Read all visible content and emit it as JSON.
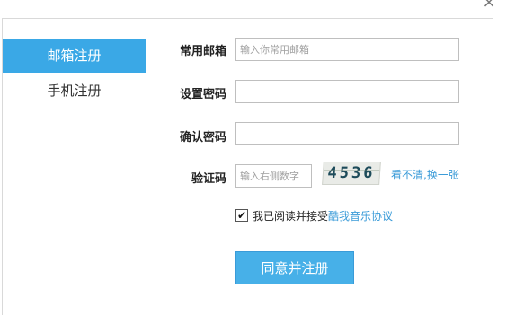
{
  "window": {
    "close_glyph": "×"
  },
  "tabs": [
    {
      "label": "邮箱注册",
      "active": true
    },
    {
      "label": "手机注册",
      "active": false
    }
  ],
  "form": {
    "email_label": "常用邮箱",
    "email_placeholder": "输入你常用邮箱",
    "email_value": "",
    "password_label": "设置密码",
    "password_value": "",
    "confirm_label": "确认密码",
    "confirm_value": "",
    "captcha_label": "验证码",
    "captcha_placeholder": "输入右侧数字",
    "captcha_image_text": "4536",
    "refresh_link": "看不清,换一张",
    "agree_checked": true,
    "agree_text": "我已阅读并接受",
    "agree_link": "酷我音乐协议",
    "submit_label": "同意并注册"
  },
  "colors": {
    "accent": "#3aa8e6",
    "link": "#3a9bd8",
    "button": "#47b0e8"
  }
}
